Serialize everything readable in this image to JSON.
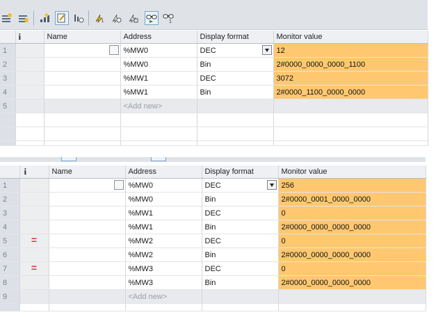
{
  "table1": {
    "headers": {
      "info": "i",
      "name": "Name",
      "address": "Address",
      "display_format": "Display format",
      "monitor_value": "Monitor value"
    },
    "rows": [
      {
        "num": "1",
        "address": "%MW0",
        "format": "DEC",
        "value": "12"
      },
      {
        "num": "2",
        "address": "%MW0",
        "format": "Bin",
        "value": "2#0000_0000_0000_1100"
      },
      {
        "num": "3",
        "address": "%MW1",
        "format": "DEC",
        "value": "3072"
      },
      {
        "num": "4",
        "address": "%MW1",
        "format": "Bin",
        "value": "2#0000_1100_0000_0000"
      }
    ],
    "add_row": {
      "num": "5",
      "placeholder": "<Add new>"
    }
  },
  "table2": {
    "headers": {
      "info": "i",
      "name": "Name",
      "address": "Address",
      "display_format": "Display format",
      "monitor_value": "Monitor value"
    },
    "rows": [
      {
        "num": "1",
        "mark": "",
        "address": "%MW0",
        "format": "DEC",
        "value": "256"
      },
      {
        "num": "2",
        "mark": "",
        "address": "%MW0",
        "format": "Bin",
        "value": "2#0000_0001_0000_0000"
      },
      {
        "num": "3",
        "mark": "",
        "address": "%MW1",
        "format": "DEC",
        "value": "0"
      },
      {
        "num": "4",
        "mark": "",
        "address": "%MW1",
        "format": "Bin",
        "value": "2#0000_0000_0000_0000"
      },
      {
        "num": "5",
        "mark": "=",
        "address": "%MW2",
        "format": "DEC",
        "value": "0"
      },
      {
        "num": "6",
        "mark": "",
        "address": "%MW2",
        "format": "Bin",
        "value": "2#0000_0000_0000_0000"
      },
      {
        "num": "7",
        "mark": "=",
        "address": "%MW3",
        "format": "DEC",
        "value": "0"
      },
      {
        "num": "8",
        "mark": "",
        "address": "%MW3",
        "format": "Bin",
        "value": "2#0000_0000_0000_0000"
      }
    ],
    "add_row": {
      "num": "9",
      "placeholder": "<Add new>"
    }
  },
  "colors": {
    "monitor_highlight": "#ffc870",
    "toolbar_bg": "#dfe3e8",
    "force_mark": "#e0303a"
  },
  "toolbar_icons": [
    "insert-row-icon",
    "add-row-icon",
    "show-all-modify-columns-icon",
    "show-expanded-mode-icon",
    "show-trigger-options-icon",
    "modify-now-icon",
    "modify-with-trigger-icon",
    "enable-peripheral-outputs-icon",
    "monitor-all-icon",
    "monitor-now-icon"
  ]
}
